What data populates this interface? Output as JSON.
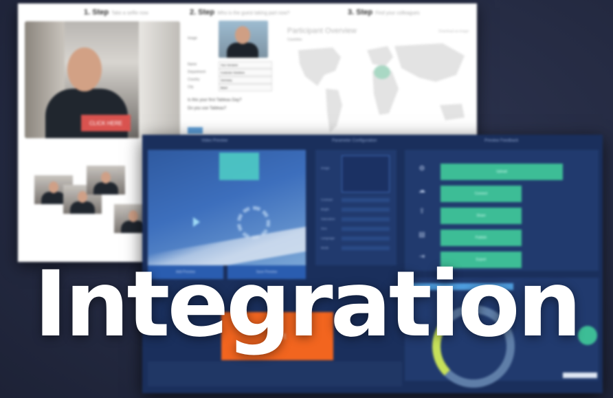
{
  "headline": "Integration",
  "back_screenshot": {
    "steps": [
      {
        "label": "1. Step",
        "note": "Take a selfie now"
      },
      {
        "label": "2. Step",
        "note": "Who is the guest taking part now?"
      },
      {
        "label": "3. Step",
        "note": "Find your colleagues"
      }
    ],
    "webcam_button": "CLICK HERE",
    "form": {
      "image_label": "Image",
      "fields": [
        {
          "label": "Name",
          "value": "Your Vorname"
        },
        {
          "label": "Department",
          "value": "Customer Solutions"
        },
        {
          "label": "Country",
          "value": "Germany"
        },
        {
          "label": "City",
          "value": "Basel"
        }
      ],
      "questions": [
        "Is this your first Tableau Day?",
        "Do you use Tableau?"
      ]
    },
    "map": {
      "title": "Participant Overview",
      "subtitle": "Countries",
      "link": "Download as image"
    }
  },
  "front_screenshot": {
    "panel_titles": [
      "Video Preview",
      "Parameter Configuration",
      "Preview Feedback"
    ],
    "video_buttons": [
      "Add Preview",
      "Save Preview"
    ],
    "config": {
      "box_label": "Image",
      "rows": [
        "Contrast",
        "Bright",
        "Saturation",
        "Size",
        "Language",
        "Mode"
      ]
    },
    "action_buttons": [
      "Upload",
      "Connect",
      "Share",
      "Publish",
      "Export"
    ],
    "orange_button": "Start"
  },
  "colors": {
    "background": "#252b43",
    "front_panel": "#1a2f5c",
    "accent_green": "#3dbd96",
    "accent_orange": "#f2651f",
    "click_red": "#d9534f"
  }
}
